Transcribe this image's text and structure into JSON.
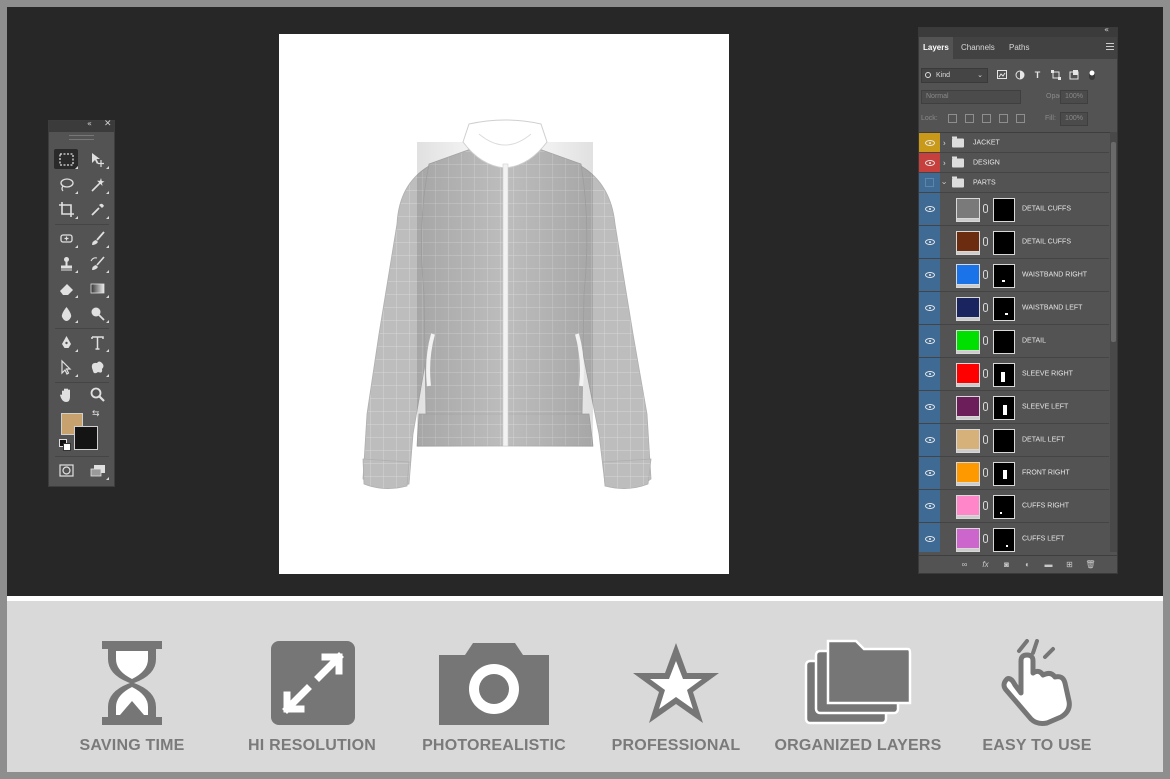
{
  "tools_panel": {
    "collapse_label": "«",
    "close_label": "✕",
    "foreground_color": "#c8a26e",
    "background_color": "#141414"
  },
  "canvas": {
    "background": "#ffffff",
    "subject": "Jacket mockup with grid texture"
  },
  "layers_panel": {
    "collapse_label": "«",
    "tabs": [
      "Layers",
      "Channels",
      "Paths"
    ],
    "active_tab": "Layers",
    "filter_kind": "Kind",
    "blend_mode": "Normal",
    "opacity_label": "Opacity:",
    "opacity_value": "100%",
    "lock_label": "Lock:",
    "fill_label": "Fill:",
    "fill_value": "100%",
    "groups": [
      {
        "name": "JACKET",
        "eye_color": "#c99a19"
      },
      {
        "name": "DESIGN",
        "eye_color": "#c6403d"
      },
      {
        "name": "PARTS",
        "eye_color": "#3e6a94"
      }
    ],
    "layers": [
      {
        "name": "DETAIL CUFFS",
        "color": "#7a7a7a"
      },
      {
        "name": "DETAIL CUFFS",
        "color": "#6b2c0f"
      },
      {
        "name": "WAISTBAND RIGHT",
        "color": "#1a73e8"
      },
      {
        "name": "WAISTBAND LEFT",
        "color": "#1a2560"
      },
      {
        "name": "DETAIL",
        "color": "#00e000"
      },
      {
        "name": "SLEEVE RIGHT",
        "color": "#ff0000"
      },
      {
        "name": "SLEEVE LEFT",
        "color": "#6b1e5a"
      },
      {
        "name": "DETAIL LEFT",
        "color": "#d6b27a"
      },
      {
        "name": "FRONT RIGHT",
        "color": "#ff9900"
      },
      {
        "name": "CUFFS RIGHT",
        "color": "#ff86c8"
      },
      {
        "name": "CUFFS  LEFT",
        "color": "#cc66cc"
      }
    ]
  },
  "features": [
    {
      "label": "SAVING TIME",
      "icon": "hourglass-icon"
    },
    {
      "label": "HI RESOLUTION",
      "icon": "expand-arrows-icon"
    },
    {
      "label": "PHOTOREALISTIC",
      "icon": "camera-icon"
    },
    {
      "label": "PROFESSIONAL",
      "icon": "star-icon"
    },
    {
      "label": "ORGANIZED LAYERS",
      "icon": "stacked-folders-icon"
    },
    {
      "label": "EASY TO USE",
      "icon": "hand-click-icon"
    }
  ]
}
